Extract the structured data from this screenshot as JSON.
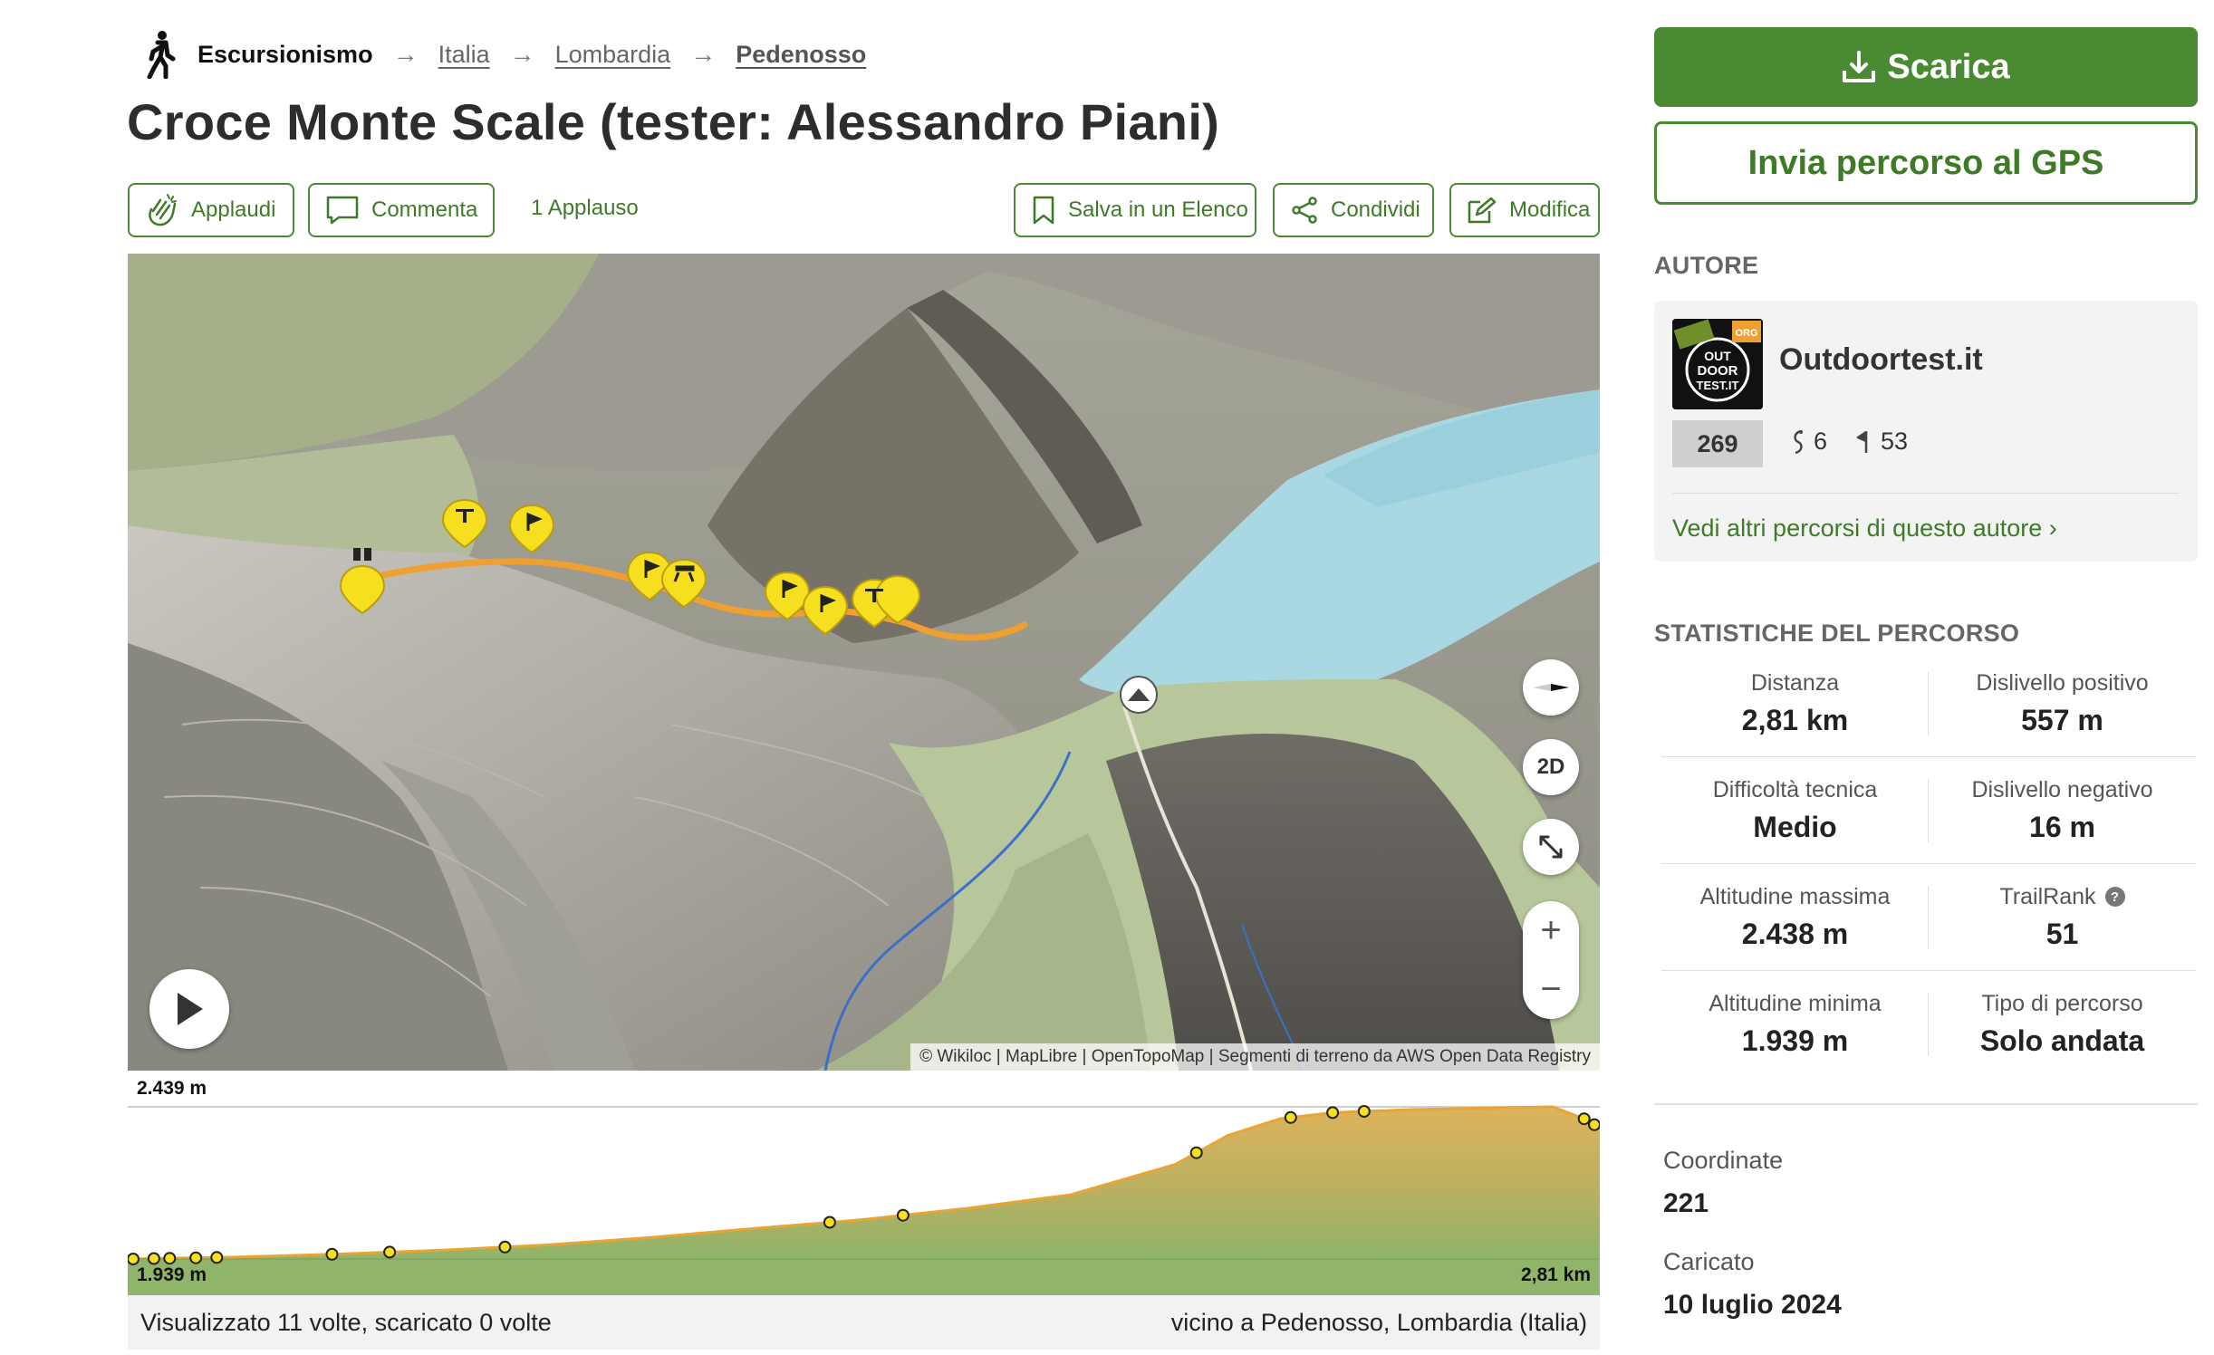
{
  "breadcrumb": {
    "category": "Escursionismo",
    "items": [
      "Italia",
      "Lombardia",
      "Pedenosso"
    ]
  },
  "title": "Croce Monte Scale (tester: Alessandro Piani)",
  "actions": {
    "applaud": "Applaudi",
    "comment": "Commenta",
    "applause_count": "1 Applauso",
    "save_list": "Salva in un Elenco",
    "share": "Condividi",
    "edit": "Modifica"
  },
  "map": {
    "mode_button": "2D",
    "zoom_in": "+",
    "zoom_out": "−",
    "attribution": "© Wikiloc | MapLibre | OpenTopoMap | Segmenti di terreno da AWS Open Data Registry"
  },
  "elevation": {
    "max_label": "2.439 m",
    "min_label": "1.939 m",
    "distance_label": "2,81 km",
    "profile": [
      {
        "km": 0.0,
        "m": 1939
      },
      {
        "km": 0.2,
        "m": 1945
      },
      {
        "km": 0.4,
        "m": 1955
      },
      {
        "km": 0.6,
        "m": 1968
      },
      {
        "km": 0.8,
        "m": 1985
      },
      {
        "km": 1.0,
        "m": 2010
      },
      {
        "km": 1.2,
        "m": 2040
      },
      {
        "km": 1.4,
        "m": 2068
      },
      {
        "km": 1.6,
        "m": 2105
      },
      {
        "km": 1.8,
        "m": 2150
      },
      {
        "km": 2.0,
        "m": 2250
      },
      {
        "km": 2.1,
        "m": 2345
      },
      {
        "km": 2.2,
        "m": 2400
      },
      {
        "km": 2.3,
        "m": 2420
      },
      {
        "km": 2.45,
        "m": 2430
      },
      {
        "km": 2.6,
        "m": 2435
      },
      {
        "km": 2.72,
        "m": 2439
      },
      {
        "km": 2.81,
        "m": 2380
      }
    ],
    "waypoints_km": [
      0.0,
      0.05,
      0.08,
      0.13,
      0.17,
      0.39,
      0.5,
      0.72,
      1.34,
      1.48,
      2.04,
      2.22,
      2.3,
      2.36,
      2.78,
      2.81
    ]
  },
  "views_text": "Visualizzato 11 volte, scaricato 0 volte",
  "location_text": "vicino a Pedenosso, Lombardia (Italia)",
  "sidebar": {
    "download": "Scarica",
    "send_gps": "Invia percorso al GPS",
    "author_heading": "AUTORE",
    "author": {
      "name": "Outdoortest.it",
      "rank": "269",
      "followers": "6",
      "trails": "53",
      "more_link": "Vedi altri percorsi di questo autore ›",
      "avatar_text": [
        "OUT",
        "DOOR",
        "TEST.IT"
      ],
      "avatar_badge": "ORG"
    },
    "stats_heading": "STATISTICHE DEL PERCORSO",
    "stats": [
      {
        "label": "Distanza",
        "value": "2,81 km"
      },
      {
        "label": "Dislivello positivo",
        "value": "557 m"
      },
      {
        "label": "Difficoltà tecnica",
        "value": "Medio"
      },
      {
        "label": "Dislivello negativo",
        "value": "16 m"
      },
      {
        "label": "Altitudine massima",
        "value": "2.438 m"
      },
      {
        "label": "TrailRank",
        "value": "51"
      },
      {
        "label": "Altitudine minima",
        "value": "1.939 m"
      },
      {
        "label": "Tipo di percorso",
        "value": "Solo andata"
      }
    ],
    "coords_label": "Coordinate",
    "coords_value": "221",
    "uploaded_label": "Caricato",
    "uploaded_value": "10 luglio 2024"
  },
  "colors": {
    "brand_green": "#4a8a32",
    "track_orange": "#f0a030",
    "waypoint_yellow": "#f5df1e"
  }
}
